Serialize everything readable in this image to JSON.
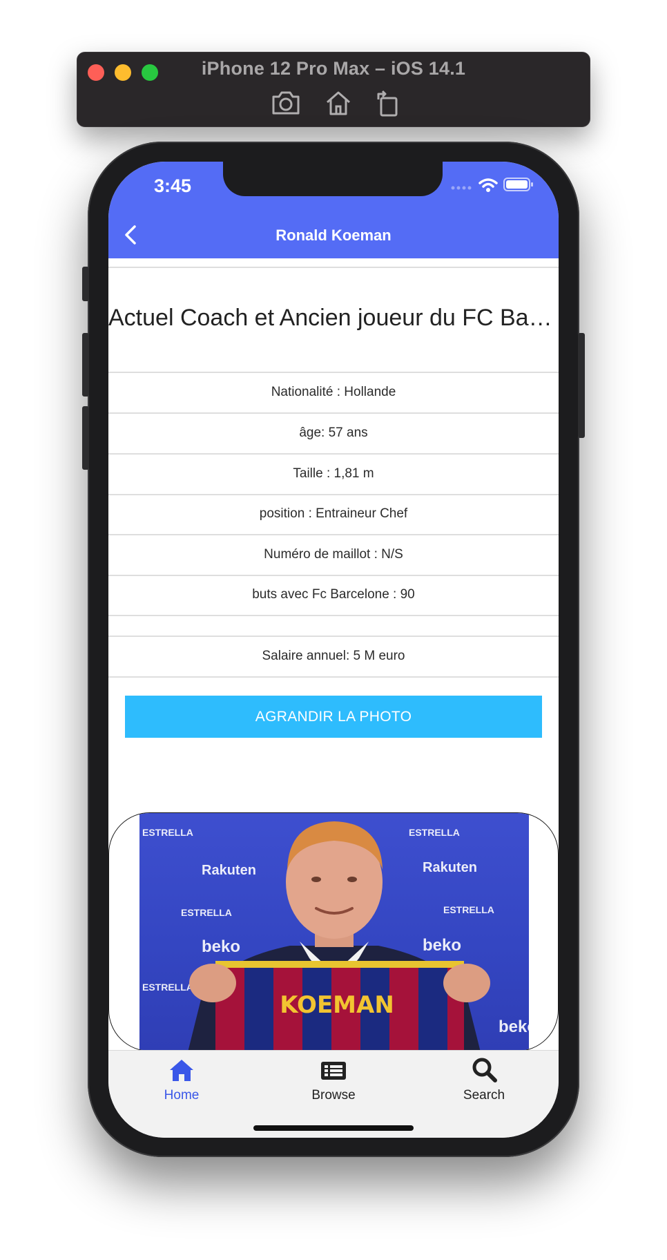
{
  "simulator": {
    "title": "iPhone 12 Pro Max – iOS 14.1",
    "tools": [
      "camera-icon",
      "home-icon",
      "rotate-icon"
    ],
    "traffic_colors": [
      "#fe5f57",
      "#febc2e",
      "#28c840"
    ]
  },
  "status_bar": {
    "time": "3:45"
  },
  "nav": {
    "title": "Ronald Koeman"
  },
  "profile": {
    "headline": "Actuel Coach et Ancien joueur du FC Barcelona",
    "rows": [
      "Nationalité : Hollande",
      "âge: 57 ans",
      "Taille : 1,81 m",
      "position : Entraineur Chef",
      "Numéro de  maillot : N/S",
      "buts avec Fc Barcelone : 90",
      "",
      "Salaire annuel: 5 M euro"
    ]
  },
  "enlarge_button": {
    "label": "AGRANDIR LA PHOTO"
  },
  "photo": {
    "sponsor_texts": [
      "ESTRELLA",
      "Rakuten",
      "beko"
    ],
    "jersey_text": "KOEMAN"
  },
  "tabbar": {
    "tabs": [
      {
        "label": "Home",
        "icon": "home-icon",
        "active": true
      },
      {
        "label": "Browse",
        "icon": "list-icon",
        "active": false
      },
      {
        "label": "Search",
        "icon": "search-icon",
        "active": false
      }
    ]
  },
  "colors": {
    "header": "#546cf5",
    "button": "#2ebcfd",
    "tab_active": "#3a57e8",
    "tab_inactive": "#222222"
  }
}
